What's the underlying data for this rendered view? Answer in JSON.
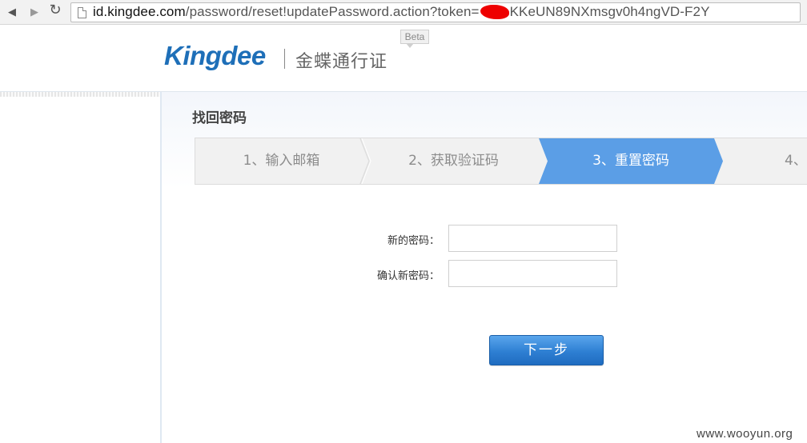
{
  "browser": {
    "url_host": "id.kingdee.com",
    "url_path_before_redaction": "/password/reset!updatePassword.action?token=",
    "url_path_after_redaction": "KKeUN89NXmsgv0h4ngVD-F2Y"
  },
  "header": {
    "logo_text": "Kingdee",
    "logo_sub": "金蝶通行证",
    "beta_badge": "Beta"
  },
  "main": {
    "title": "找回密码",
    "steps": [
      {
        "label": "1、输入邮箱",
        "active": false
      },
      {
        "label": "2、获取验证码",
        "active": false
      },
      {
        "label": "3、重置密码",
        "active": true
      },
      {
        "label": "4、",
        "active": false
      }
    ],
    "form": {
      "new_password_label": "新的密码：",
      "new_password_value": "",
      "confirm_password_label": "确认新密码：",
      "confirm_password_value": ""
    },
    "next_button": "下一步"
  },
  "watermark": "www.wooyun.org",
  "colors": {
    "brand_blue": "#1e6fb8",
    "active_step": "#5b9ee6",
    "button_blue": "#2e7fd3",
    "redaction": "#ee0000"
  }
}
